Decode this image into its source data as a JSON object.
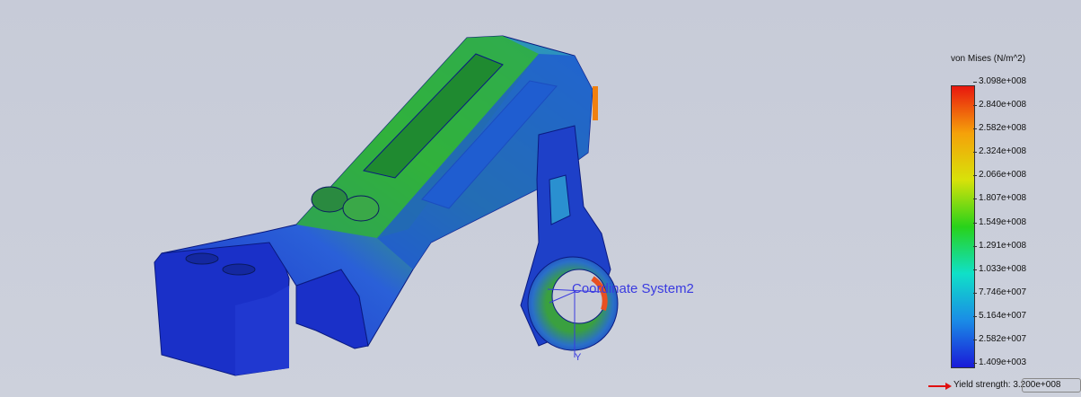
{
  "viewport": {
    "coord_system_label": "Coordinate System2",
    "axis_y_label": "Y"
  },
  "legend": {
    "title": "von Mises (N/m^2)",
    "ticks": [
      "3.098e+008",
      "2.840e+008",
      "2.582e+008",
      "2.324e+008",
      "2.066e+008",
      "1.807e+008",
      "1.549e+008",
      "1.291e+008",
      "1.033e+008",
      "7.746e+007",
      "5.164e+007",
      "2.582e+007",
      "1.409e+003"
    ],
    "colors": [
      "#e8170f",
      "#f5a10a",
      "#d8e20a",
      "#28d21a",
      "#10e0c8",
      "#1a8ce6",
      "#1a1ad8"
    ]
  },
  "yield": {
    "label": "Yield strength: 3.200e+008",
    "arrow_color": "#e01010"
  }
}
